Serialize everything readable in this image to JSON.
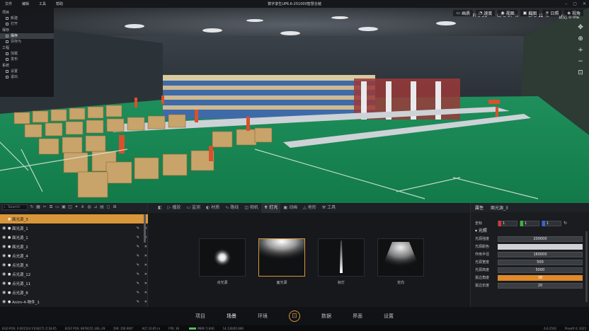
{
  "menubar": {
    "items": [
      "文件",
      "编辑",
      "工具",
      "帮助"
    ],
    "title": "数字孪生UP6.6-251000智慧仓储"
  },
  "sidemenu": [
    {
      "group": "项目",
      "items": [
        "新建",
        "打开"
      ]
    },
    {
      "group": "保存",
      "items": [
        "保存",
        "另存为"
      ]
    },
    {
      "group": "工程",
      "items": [
        "加载",
        "发布"
      ]
    },
    {
      "group": "系统",
      "items": [
        "设置",
        "退出"
      ]
    }
  ],
  "stats": {
    "fps_label": "FPS",
    "fps": "31",
    "gpu_label": "GPU",
    "gpu": "97 %",
    "cpu_label": "CPU",
    "cpu": "12 %",
    "latency_label": "延迟",
    "latency": "0 ms"
  },
  "viewtools": [
    "画质",
    "速度",
    "视图",
    "截图",
    "日照",
    "视角"
  ],
  "layers": {
    "search_placeholder": "Search",
    "items": [
      "面光源_3",
      "面光源_1",
      "面光源_1",
      "面光源_2",
      "点光源_4",
      "点光源_6",
      "点光源_12",
      "点光源_11",
      "点光源_8",
      "Anim-4-物件_1"
    ]
  },
  "center": {
    "tabs": [
      "模型",
      "播放",
      "监测",
      "材质",
      "路线",
      "相机",
      "灯光",
      "动画",
      "地形",
      "工具"
    ],
    "active_tab": "灯光",
    "lights": [
      "点光源",
      "面光源",
      "射灯",
      "定向"
    ]
  },
  "properties": {
    "header": "属性",
    "name": "面光源_3",
    "pos_label": "坐标",
    "xyz": [
      "1",
      "1",
      "1"
    ],
    "section": "光照",
    "rows": [
      {
        "label": "光源强度",
        "value": "200000"
      },
      {
        "label": "光源颜色",
        "value": ""
      },
      {
        "label": "作用半径",
        "value": "160000"
      },
      {
        "label": "光源宽度",
        "value": "500"
      },
      {
        "label": "光源高度",
        "value": "5000"
      },
      {
        "label": "拔边角度",
        "value": "38"
      },
      {
        "label": "拔边长度",
        "value": "20"
      }
    ]
  },
  "nav": {
    "items": [
      "项目",
      "场景",
      "环境",
      "数据",
      "界面",
      "设置"
    ],
    "active": "场景"
  },
  "status": {
    "text1": "EGO POS: X:001524 Y:030271 Z:18.65",
    "text2": "ECEF POS: 6878155.166,-29",
    "text3": "DIR: 356.900°",
    "text4": "ALT: 10.65 m",
    "text5": "FPS: 36",
    "text6": "MEM: 5.840",
    "text7": "14.130/65.666",
    "text8": "6.6.2502",
    "text9": "Pixsoft © 2025"
  },
  "colors": {
    "accent": "#d9963a",
    "floor": "#17925a"
  }
}
